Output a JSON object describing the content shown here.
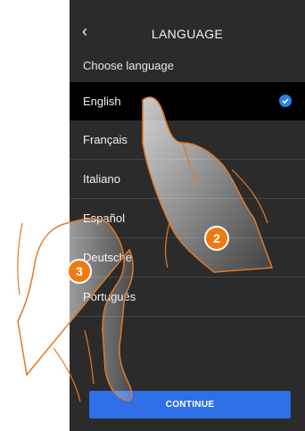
{
  "header": {
    "title": "LANGUAGE"
  },
  "subtitle": "Choose language",
  "languages": [
    {
      "label": "English",
      "selected": true
    },
    {
      "label": "Français"
    },
    {
      "label": "Italiano"
    },
    {
      "label": "Español"
    },
    {
      "label": "Deutsche"
    },
    {
      "label": "Português"
    }
  ],
  "continue_label": "CONTINUE",
  "step_badges": [
    "2",
    "3"
  ],
  "colors": {
    "accent": "#2f6fe8",
    "badge": "#f07a12",
    "background": "#2b2b2b"
  }
}
